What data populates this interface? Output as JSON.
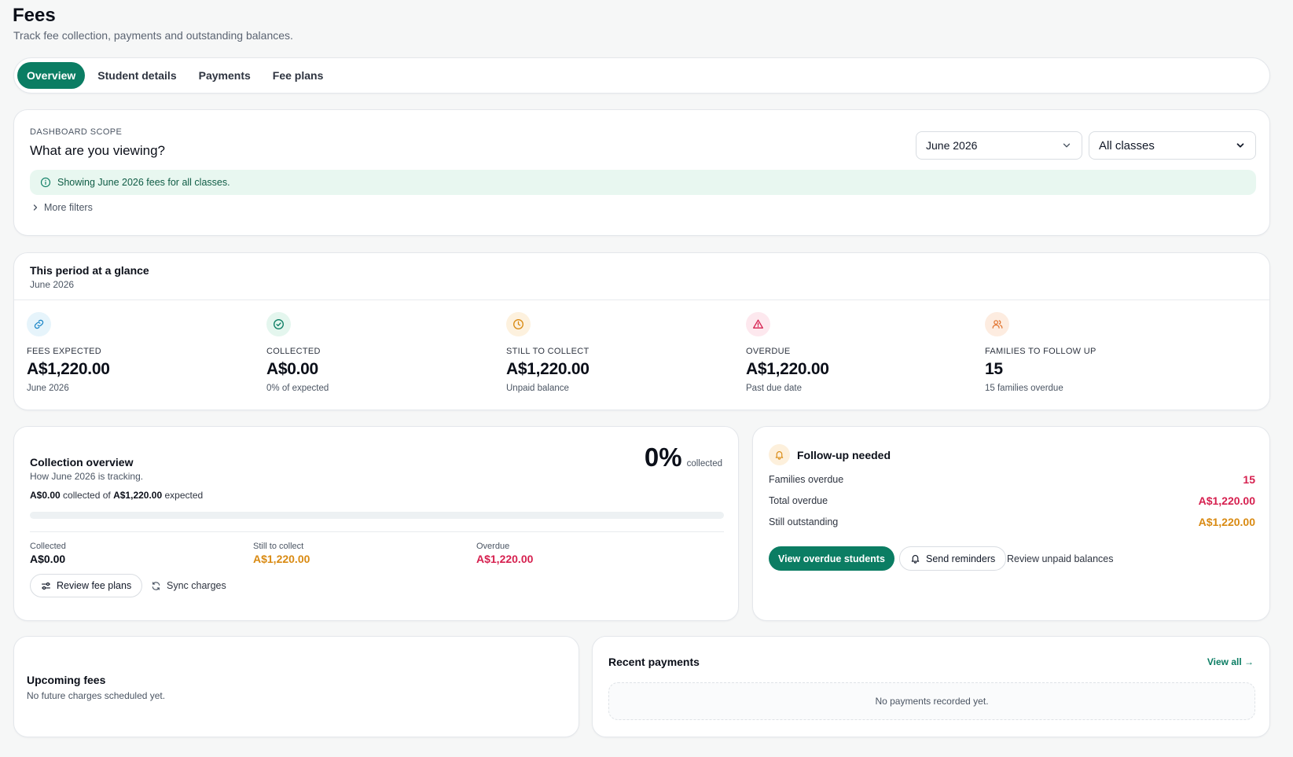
{
  "header": {
    "title": "Fees",
    "subtitle": "Track fee collection, payments and outstanding balances."
  },
  "tabs": [
    {
      "label": "Overview",
      "active": true
    },
    {
      "label": "Student details",
      "active": false
    },
    {
      "label": "Payments",
      "active": false
    },
    {
      "label": "Fee plans",
      "active": false
    }
  ],
  "scope": {
    "eyebrow": "DASHBOARD SCOPE",
    "title": "What are you viewing?",
    "month_select": "June 2026",
    "class_select": "All classes",
    "info": "Showing June 2026 fees for all classes.",
    "more_filters": "More filters"
  },
  "glance": {
    "title": "This period at a glance",
    "period": "June 2026",
    "stats": [
      {
        "label": "FEES EXPECTED",
        "value": "A$1,220.00",
        "note": "June 2026",
        "icon": "link-icon",
        "color": "#1e87c7",
        "bg": "#e6f4fb"
      },
      {
        "label": "COLLECTED",
        "value": "A$0.00",
        "note": "0% of expected",
        "icon": "check-circle-icon",
        "color": "#0b7d63",
        "bg": "#e4f6ee"
      },
      {
        "label": "STILL TO COLLECT",
        "value": "A$1,220.00",
        "note": "Unpaid balance",
        "icon": "clock-icon",
        "color": "#d98a12",
        "bg": "#fdf1de"
      },
      {
        "label": "OVERDUE",
        "value": "A$1,220.00",
        "note": "Past due date",
        "icon": "warning-icon",
        "color": "#d6204f",
        "bg": "#fde8ee"
      },
      {
        "label": "FAMILIES TO FOLLOW UP",
        "value": "15",
        "note": "15 families overdue",
        "icon": "users-icon",
        "color": "#e0702a",
        "bg": "#fdece0"
      }
    ]
  },
  "collection": {
    "title": "Collection overview",
    "subtitle": "How June 2026 is tracking.",
    "collected_amount": "A$0.00",
    "collected_of": "collected of",
    "expected_amount": "A$1,220.00",
    "expected_word": "expected",
    "percent": "0%",
    "percent_label": "collected",
    "progress_fraction": 0,
    "collected_label": "Collected",
    "collected_value": "A$0.00",
    "still_label": "Still to collect",
    "still_value": "A$1,220.00",
    "overdue_label": "Overdue",
    "overdue_value": "A$1,220.00",
    "review_button": "Review fee plans",
    "sync_button": "Sync charges"
  },
  "followup": {
    "title": "Follow-up needed",
    "rows": [
      {
        "label": "Families overdue",
        "value": "15",
        "color": "#d6204f"
      },
      {
        "label": "Total overdue",
        "value": "A$1,220.00",
        "color": "#d6204f"
      },
      {
        "label": "Still outstanding",
        "value": "A$1,220.00",
        "color": "#d98a12"
      }
    ],
    "view_button": "View overdue students",
    "reminders_button": "Send reminders",
    "review_link": "Review unpaid balances"
  },
  "upcoming": {
    "title": "Upcoming fees",
    "empty": "No future charges scheduled yet."
  },
  "recent": {
    "title": "Recent payments",
    "view_all": "View all →",
    "empty": "No payments recorded yet."
  },
  "colors": {
    "accent": "#0b7d63",
    "danger": "#d6204f",
    "warning": "#d98a12"
  }
}
